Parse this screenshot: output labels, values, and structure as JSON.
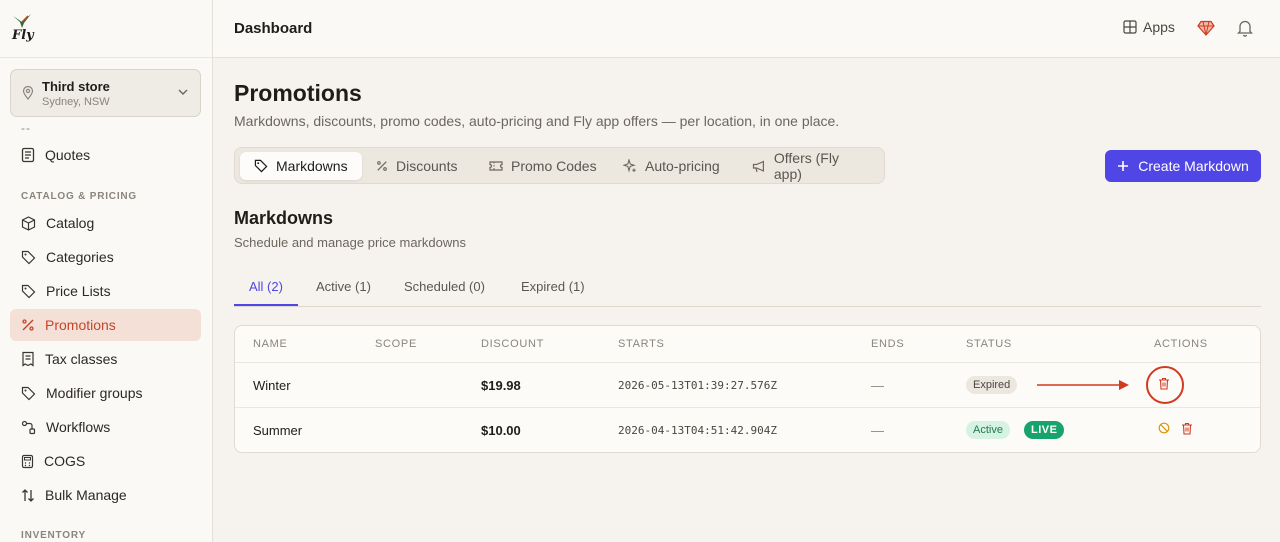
{
  "sidebar": {
    "logo_text": "Fly",
    "store": {
      "name": "Third store",
      "location": "Sydney, NSW"
    },
    "truncated_marker": "--",
    "items_top": [
      {
        "label": "Quotes",
        "icon": "document-icon"
      }
    ],
    "section_catalog": "CATALOG & PRICING",
    "items": [
      {
        "label": "Catalog",
        "icon": "box-icon"
      },
      {
        "label": "Categories",
        "icon": "tag-icon"
      },
      {
        "label": "Price Lists",
        "icon": "tag-icon"
      },
      {
        "label": "Promotions",
        "icon": "percent-icon",
        "active": true
      },
      {
        "label": "Tax classes",
        "icon": "receipt-icon"
      },
      {
        "label": "Modifier groups",
        "icon": "tag-icon"
      },
      {
        "label": "Workflows",
        "icon": "workflow-icon"
      },
      {
        "label": "COGS",
        "icon": "calculator-icon"
      },
      {
        "label": "Bulk Manage",
        "icon": "sort-icon"
      }
    ],
    "section_inventory": "INVENTORY"
  },
  "topbar": {
    "title": "Dashboard",
    "apps_label": "Apps"
  },
  "page": {
    "title": "Promotions",
    "subtitle": "Markdowns, discounts, promo codes, auto-pricing and Fly app offers — per location, in one place."
  },
  "tabs": [
    {
      "label": "Markdowns",
      "icon": "tag-icon",
      "active": true
    },
    {
      "label": "Discounts",
      "icon": "percent-icon"
    },
    {
      "label": "Promo Codes",
      "icon": "ticket-icon"
    },
    {
      "label": "Auto-pricing",
      "icon": "sparkle-icon"
    },
    {
      "label": "Offers (Fly app)",
      "icon": "megaphone-icon"
    }
  ],
  "create_button_label": "Create Markdown",
  "section": {
    "title": "Markdowns",
    "subtitle": "Schedule and manage price markdowns"
  },
  "filters": [
    {
      "label": "All (2)",
      "active": true
    },
    {
      "label": "Active (1)"
    },
    {
      "label": "Scheduled (0)"
    },
    {
      "label": "Expired (1)"
    }
  ],
  "table": {
    "headers": [
      "NAME",
      "SCOPE",
      "DISCOUNT",
      "STARTS",
      "ENDS",
      "STATUS",
      "ACTIONS"
    ],
    "rows": [
      {
        "name": "Winter",
        "scope": "",
        "discount": "$19.98",
        "starts": "2026-05-13T01:39:27.576Z",
        "ends": "—",
        "status": "Expired"
      },
      {
        "name": "Summer",
        "scope": "",
        "discount": "$10.00",
        "starts": "2026-04-13T04:51:42.904Z",
        "ends": "—",
        "status": "Active",
        "live": "LIVE"
      }
    ]
  },
  "colors": {
    "accent": "#4f46e5",
    "active_nav_text": "#c2462a",
    "annotation": "#d23a20",
    "live_green": "#19a36c"
  }
}
